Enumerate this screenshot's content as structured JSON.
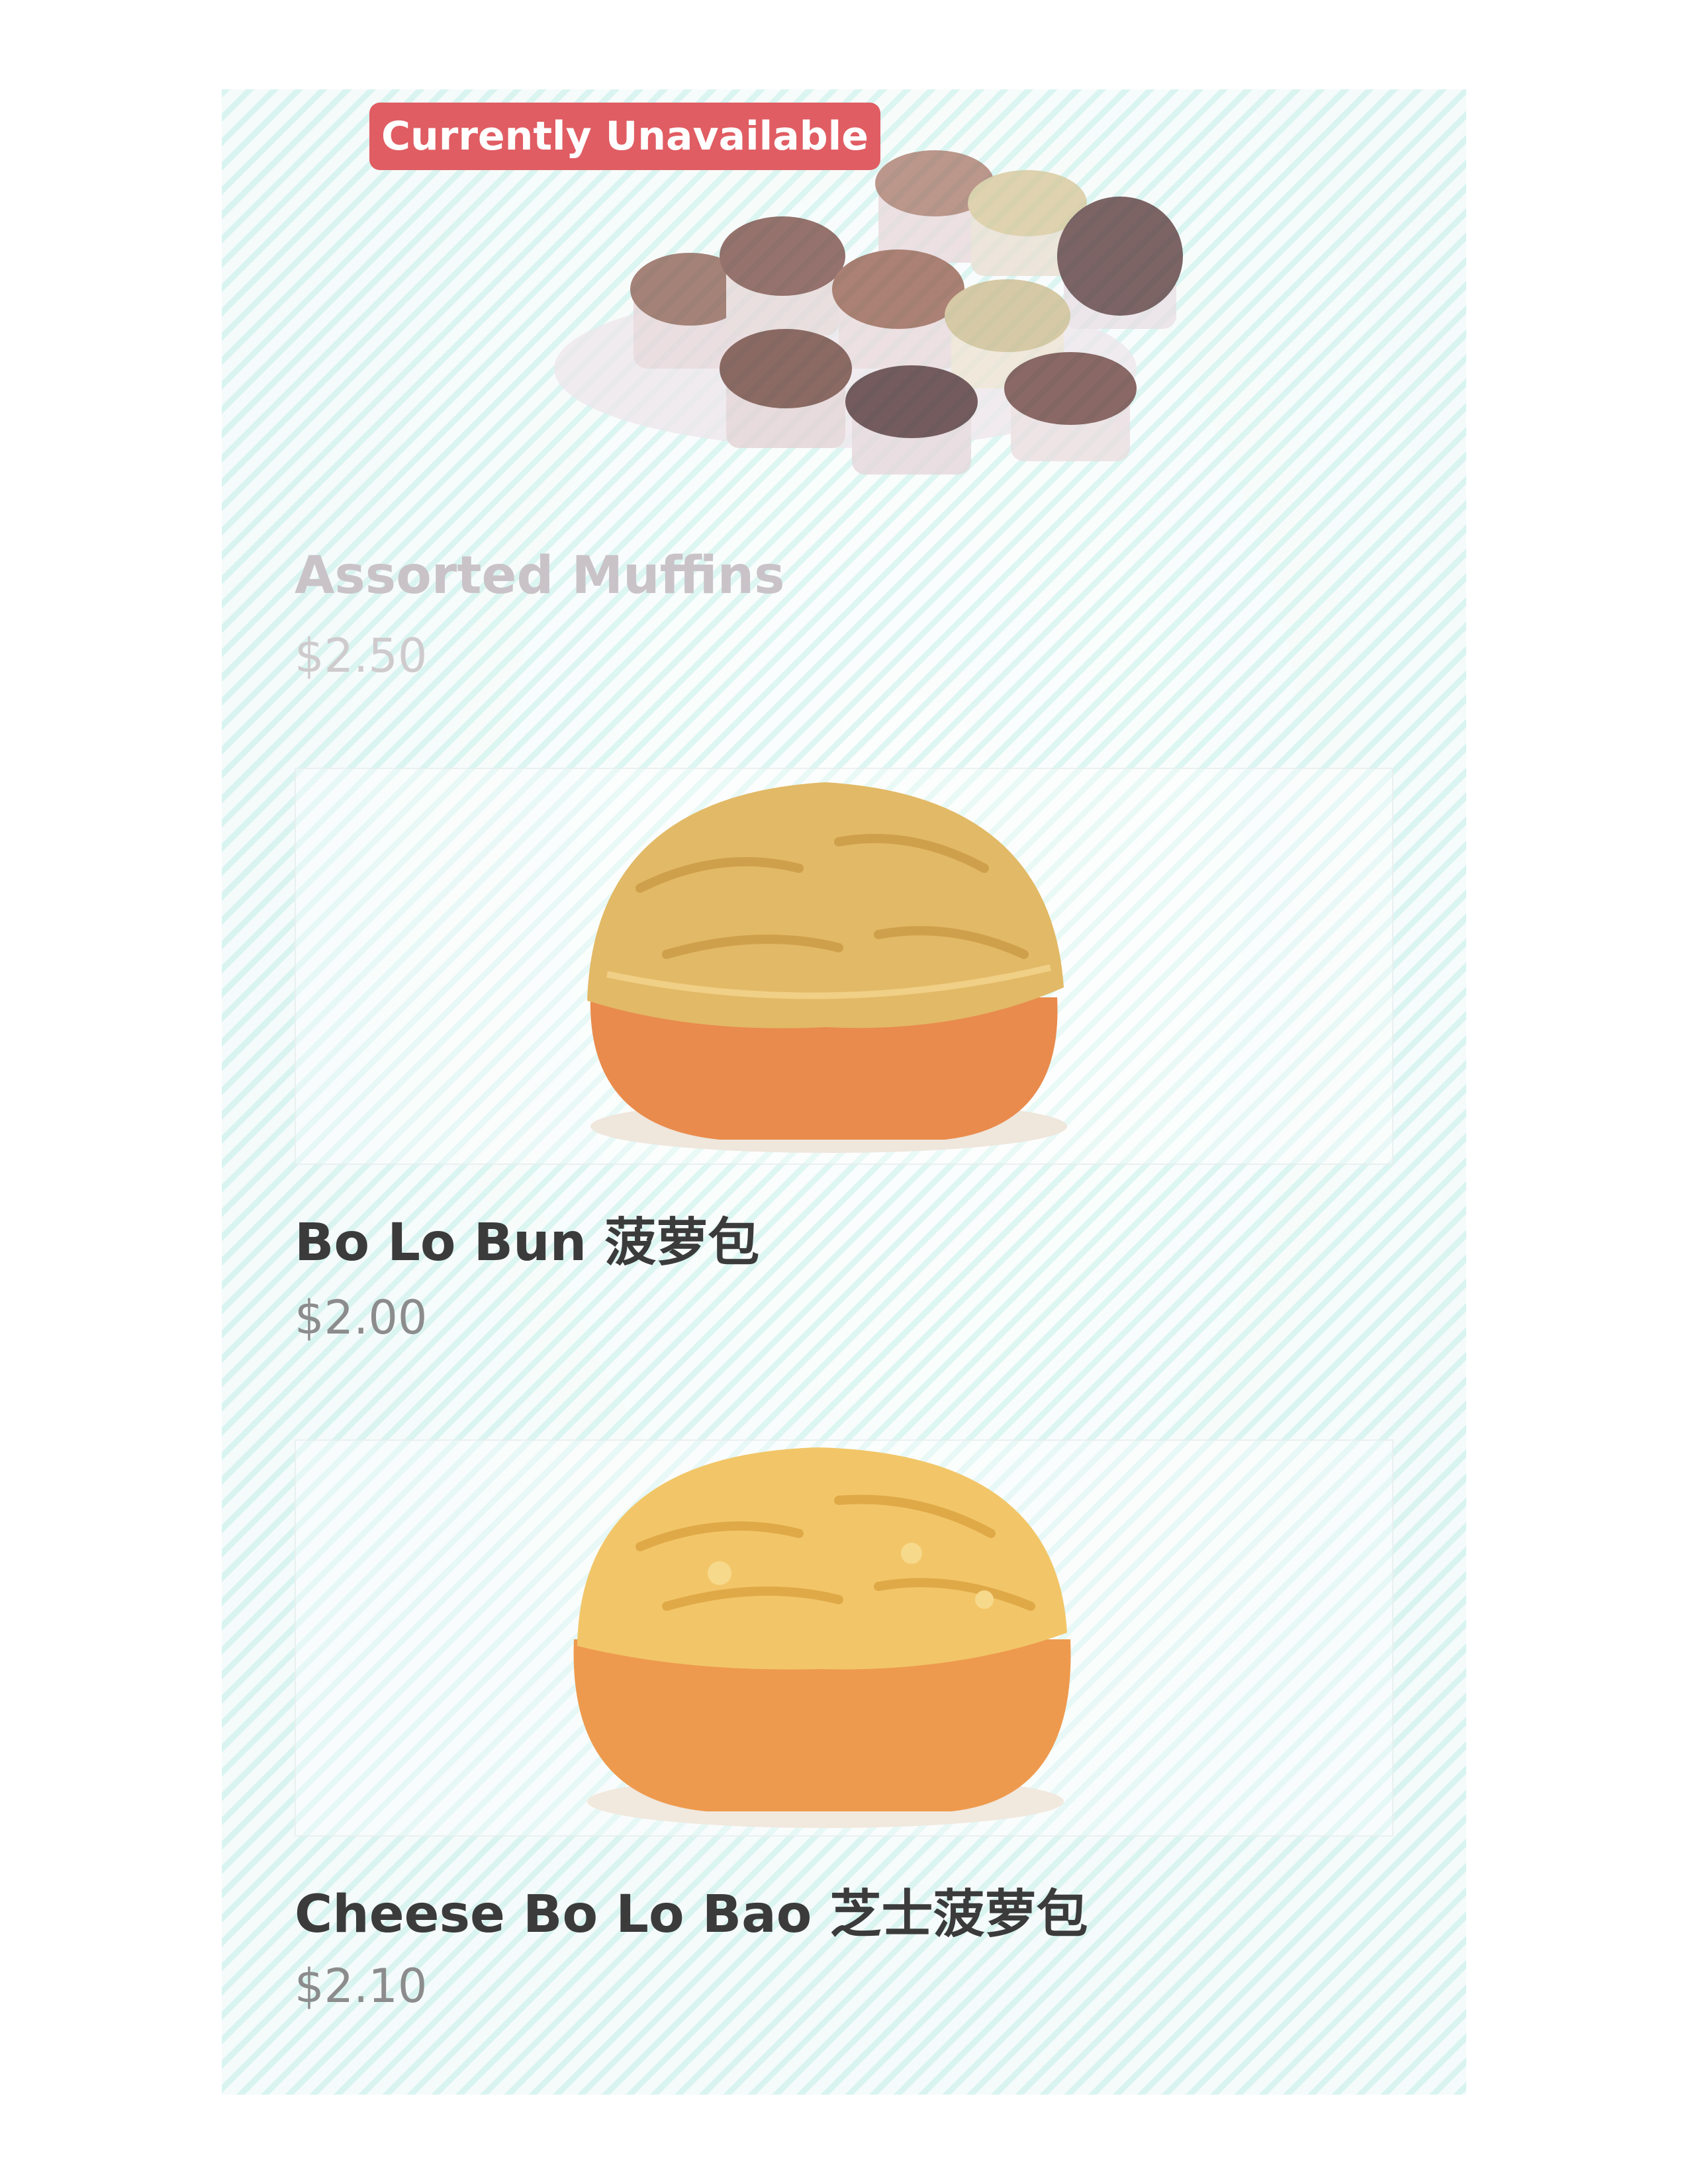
{
  "menu": {
    "items": [
      {
        "name": "Assorted Muffins",
        "price": "$2.50",
        "badge": "Currently Unavailable",
        "available": false
      },
      {
        "name": "Bo Lo Bun 菠萝包",
        "price": "$2.00",
        "available": true
      },
      {
        "name": "Cheese Bo Lo Bao 芝士菠萝包",
        "price": "$2.10",
        "available": true
      }
    ]
  },
  "colors": {
    "badge_background": "#e05d63",
    "badge_text": "#ffffff",
    "name_text": "#3b3b3b",
    "price_text": "#8c8c8c"
  }
}
